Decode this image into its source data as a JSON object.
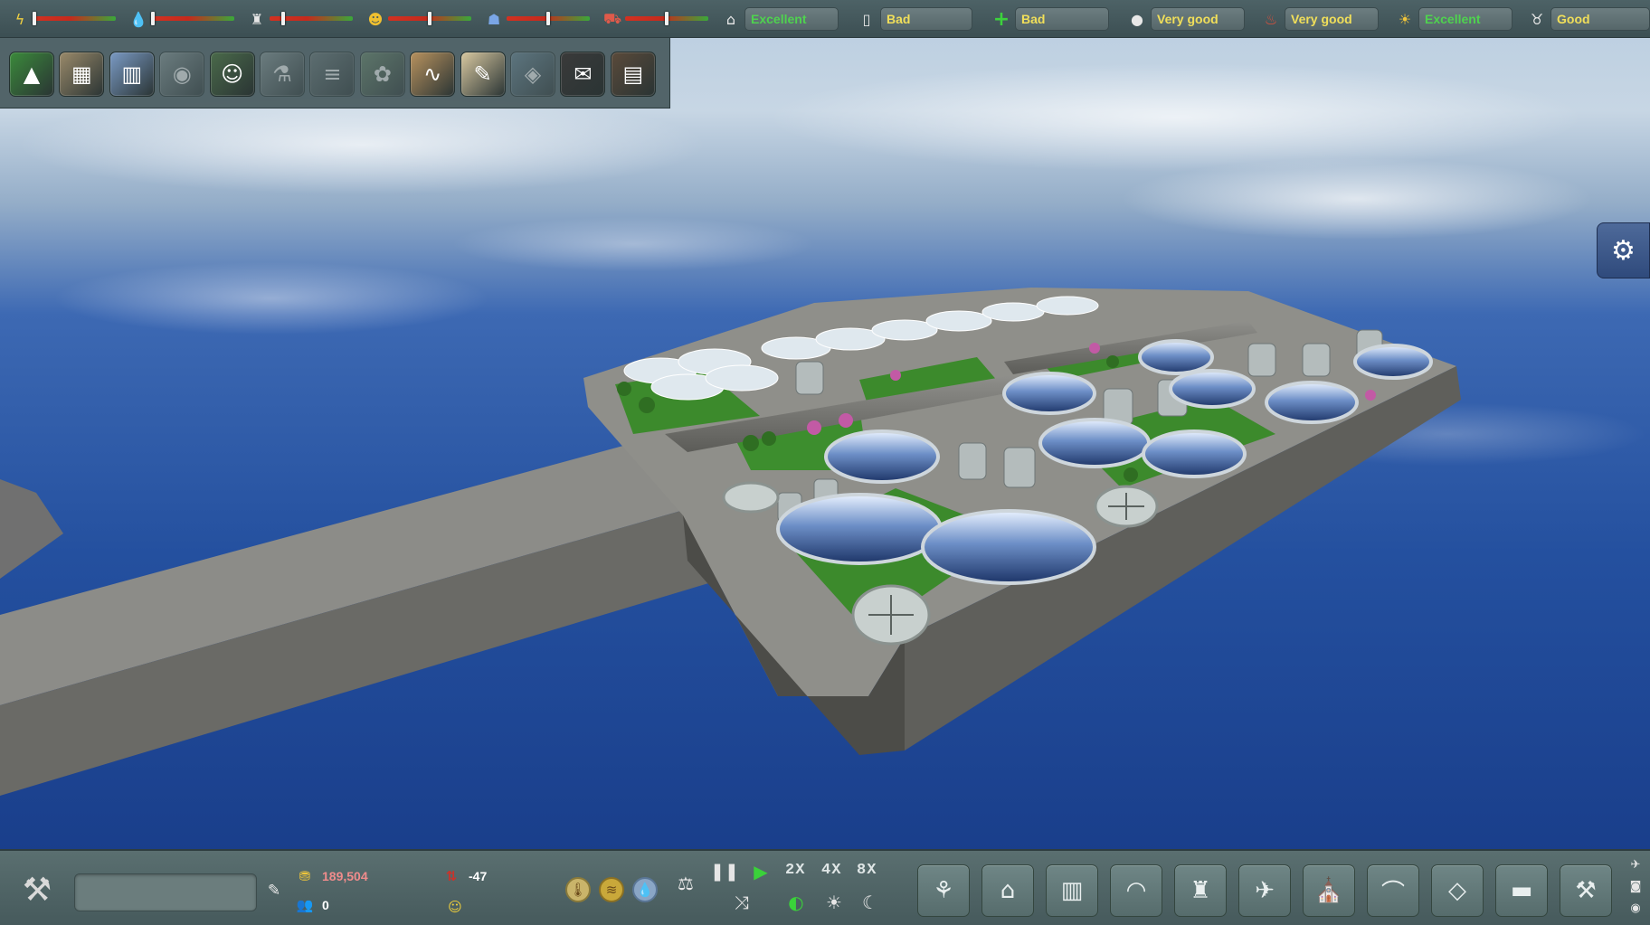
{
  "status_meters": [
    {
      "icon": "power-icon",
      "level": 0.0
    },
    {
      "icon": "water-drop-icon",
      "level": 0.0
    },
    {
      "icon": "resource-sack-icon",
      "level": 0.15
    },
    {
      "icon": "workers-icon",
      "level": 0.5
    },
    {
      "icon": "police-icon",
      "level": 0.5
    },
    {
      "icon": "fire-truck-icon",
      "level": 0.5
    }
  ],
  "ratings": [
    {
      "icon": "housing-icon",
      "label": "Excellent",
      "tone": "excellent"
    },
    {
      "icon": "education-icon",
      "label": "Bad",
      "tone": "bad"
    },
    {
      "icon": "health-cross-icon",
      "label": "Bad",
      "tone": "bad"
    },
    {
      "icon": "pollution-icon",
      "label": "Very good",
      "tone": "good"
    },
    {
      "icon": "fire-safety-icon",
      "label": "Very good",
      "tone": "good"
    },
    {
      "icon": "entertainment-icon",
      "label": "Excellent",
      "tone": "excellent"
    },
    {
      "icon": "cow-icon",
      "label": "Good",
      "tone": "good"
    }
  ],
  "categories": [
    {
      "name": "terrain-category",
      "glyph": "▲",
      "dim": false,
      "color": "#3b8a3b"
    },
    {
      "name": "zoning-category",
      "glyph": "▦",
      "dim": false,
      "color": "#9a8a6a"
    },
    {
      "name": "city-category",
      "glyph": "▥",
      "dim": false,
      "color": "#7a9ac4"
    },
    {
      "name": "landmark-category",
      "glyph": "◉",
      "dim": true,
      "color": "#8a9a9a"
    },
    {
      "name": "population-category",
      "glyph": "☺",
      "dim": false,
      "color": "#4a6a4a"
    },
    {
      "name": "research-category",
      "glyph": "⚗",
      "dim": true,
      "color": "#8a9a9a"
    },
    {
      "name": "roads-category",
      "glyph": "≡",
      "dim": true,
      "color": "#6a7a7a"
    },
    {
      "name": "parks-category",
      "glyph": "✿",
      "dim": true,
      "color": "#6a8a6a"
    },
    {
      "name": "graphs-category",
      "glyph": "∿",
      "dim": false,
      "color": "#b8925e"
    },
    {
      "name": "policies-category",
      "glyph": "✎",
      "dim": false,
      "color": "#d8c8a0"
    },
    {
      "name": "districts-category",
      "glyph": "◈",
      "dim": true,
      "color": "#6a8a9a"
    },
    {
      "name": "mail-category",
      "glyph": "✉",
      "dim": false,
      "color": "#3a3a3a"
    },
    {
      "name": "library-category",
      "glyph": "▤",
      "dim": false,
      "color": "#5a4a3a"
    }
  ],
  "bottom": {
    "city_name": "",
    "money": "189,504",
    "population": "0",
    "balance": "-47",
    "speed_2x": "2X",
    "speed_4x": "4X",
    "speed_8x": "8X"
  },
  "build_buttons": [
    "wind-power-build",
    "residential-build",
    "industrial-build",
    "dome-build",
    "factory-build",
    "runway-build",
    "government-build",
    "farm-build",
    "structure-build",
    "storage-build",
    "crane-build"
  ],
  "colors": {
    "ocean": "#1d4796",
    "platform": "#8a8a86",
    "grass": "#3c8a2c"
  }
}
